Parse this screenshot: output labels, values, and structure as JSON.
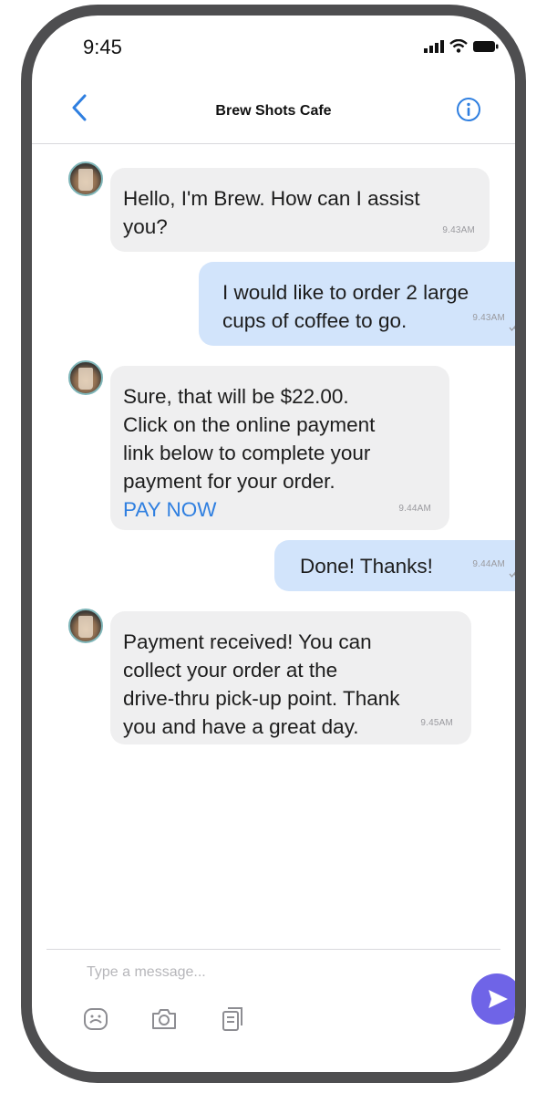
{
  "status_bar": {
    "time": "9:45"
  },
  "header": {
    "title": "Brew Shots Cafe"
  },
  "messages": [
    {
      "text": "Hello, I'm Brew. How can I assist\nyou?",
      "time": "9.43AM"
    },
    {
      "text": "I would like to order 2 large\ncups of coffee to go.",
      "time": "9.43AM"
    },
    {
      "text": "Sure, that will be $22.00.\nClick on the online payment\nlink below to complete your\npayment for your order.",
      "link": "PAY NOW",
      "time": "9.44AM"
    },
    {
      "text": "Done! Thanks!",
      "time": "9.44AM"
    },
    {
      "text": "Payment received! You can\ncollect your order at the\ndrive-thru pick-up point. Thank\nyou and have a great day.",
      "time": "9.45AM"
    }
  ],
  "composer": {
    "placeholder": "Type a message..."
  },
  "icons": {
    "back": "chevron-left-icon",
    "info": "info-icon",
    "emoji": "sticker-icon",
    "camera": "camera-icon",
    "attach": "document-icon",
    "send": "send-icon"
  },
  "colors": {
    "accent": "#6f64e7",
    "link": "#2f7fe0",
    "incoming_bubble": "#efeff0",
    "outgoing_bubble": "#d2e4fb",
    "frame": "#4e4e50"
  }
}
